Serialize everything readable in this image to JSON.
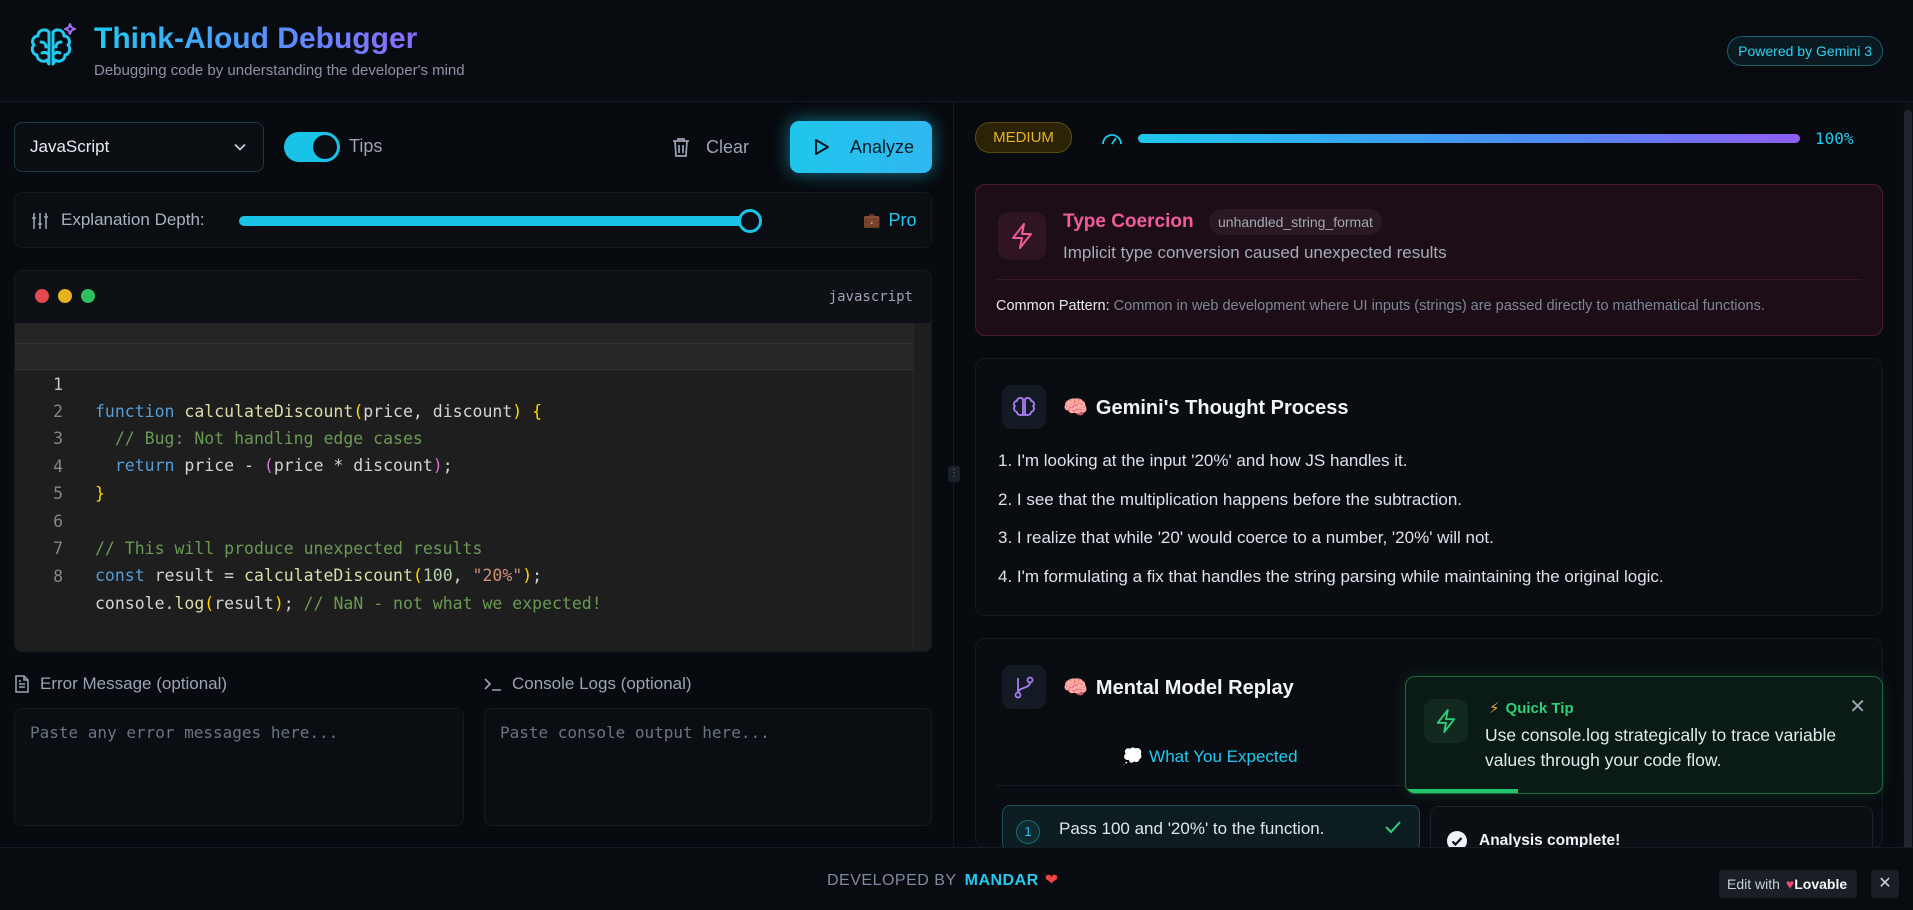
{
  "header": {
    "title": "Think-Aloud Debugger",
    "subtitle": "Debugging code by understanding the developer's mind",
    "powered_by": "Powered by Gemini 3"
  },
  "toolbar": {
    "language": "JavaScript",
    "tips_label": "Tips",
    "tips_enabled": true,
    "clear_label": "Clear",
    "analyze_label": "Analyze"
  },
  "depth": {
    "label": "Explanation Depth:",
    "level_label": "Pro",
    "slider_value_fraction": 1.0
  },
  "editor": {
    "language_tag": "javascript",
    "line_numbers": [
      "1",
      "2",
      "3",
      "4",
      "5",
      "6",
      "7",
      "8"
    ],
    "lines": [
      "function calculateDiscount(price, discount) {",
      "  // Bug: Not handling edge cases",
      "  return price - (price * discount);",
      "}",
      "",
      "// This will produce unexpected results",
      "const result = calculateDiscount(100, \"20%\");",
      "console.log(result); // NaN - not what we expected!"
    ]
  },
  "error_section": {
    "label": "Error Message (optional)",
    "placeholder": "Paste any error messages here..."
  },
  "console_section": {
    "label": "Console Logs (optional)",
    "placeholder": "Paste console output here..."
  },
  "analysis": {
    "severity": "MEDIUM",
    "progress_percent": 100,
    "progress_text": "100%",
    "bug": {
      "title": "Type Coercion",
      "code": "unhandled_string_format",
      "description": "Implicit type conversion caused unexpected results",
      "pattern_label": "Common Pattern:",
      "pattern_text": "Common in web development where UI inputs (strings) are passed directly to mathematical functions."
    },
    "thought_process": {
      "title": "Gemini's Thought Process",
      "steps": [
        "1. I'm looking at the input '20%' and how JS handles it.",
        "2. I see that the multiplication happens before the subtraction.",
        "3. I realize that while '20' would coerce to a number, '20%' will not.",
        "4. I'm formulating a fix that handles the string parsing while maintaining the original logic."
      ]
    },
    "mental_model": {
      "title": "Mental Model Replay",
      "expected_label": "What You Expected",
      "steps": [
        {
          "number": "1",
          "text": "Pass 100 and '20%' to the function."
        }
      ]
    }
  },
  "quick_tip": {
    "label": "Quick Tip",
    "text": "Use console.log strategically to trace variable values through your code flow."
  },
  "toast": {
    "text": "Analysis complete!"
  },
  "footer": {
    "developed_by": "DEVELOPED BY",
    "name": "MANDAR",
    "edit_with": "Edit with",
    "lovable": "Lovable"
  },
  "colors": {
    "accent": "#22c9f0",
    "bug": "#f05b9a",
    "warning": "#e6b422",
    "success": "#2fd07a"
  },
  "icons": {
    "logo": "brain-icon",
    "thought": "brain-icon",
    "mental_model": "git-branch-icon",
    "bug": "lightning-icon",
    "tip": "lightning-icon"
  }
}
